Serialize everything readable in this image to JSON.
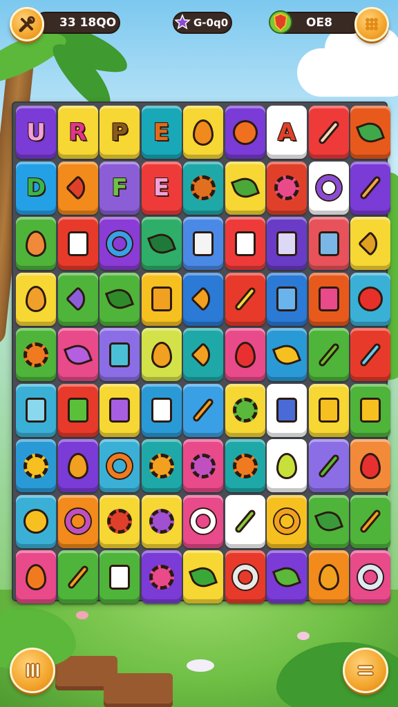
{
  "hud": {
    "score_text": "33 18QO",
    "level_text": "G-0ԛ0",
    "coins_text": "OE8",
    "colors": {
      "pill_bg": "#3a2a24",
      "button_orange": "#f3a52c",
      "star_purple": "#8b4bd6",
      "shield_red": "#e0402a"
    },
    "icons": {
      "left_button": "tools-icon",
      "star": "star-icon",
      "shield": "shield-icon",
      "right_button": "grid-menu-icon"
    }
  },
  "board": {
    "rows": [
      [
        {
          "bg": "#7a3bd6",
          "glyph": "U",
          "glyphColor": "#f4a0d8"
        },
        {
          "bg": "#f6d733",
          "glyph": "R",
          "glyphColor": "#e2348a"
        },
        {
          "bg": "#f6d733",
          "glyph": "P",
          "glyphColor": "#8a5a1a"
        },
        {
          "bg": "#19a8b8",
          "glyph": "E",
          "glyphColor": "#e06a1c"
        },
        {
          "bg": "#f6d733",
          "icon": "fruit-icon",
          "shape": "drop",
          "color": "#f08a1c"
        },
        {
          "bg": "#7a3bd6",
          "icon": "donut-icon",
          "shape": "round",
          "color": "#f07020"
        },
        {
          "bg": "#ffffff",
          "glyph": "A",
          "glyphColor": "#e0402a"
        },
        {
          "bg": "#ef3a3a",
          "icon": "pencil-icon",
          "shape": "stick",
          "color": "#f3d9c0"
        },
        {
          "bg": "#e85a1c",
          "icon": "leaf-icon",
          "shape": "leafy",
          "color": "#3fa84a"
        }
      ],
      [
        {
          "bg": "#24a0e6",
          "glyph": "D",
          "glyphColor": "#39b54a"
        },
        {
          "bg": "#f28a1c",
          "icon": "heart-icon",
          "shape": "arrow",
          "color": "#e0402a"
        },
        {
          "bg": "#8b5ed8",
          "glyph": "F",
          "glyphColor": "#6ec04a"
        },
        {
          "bg": "#ef3a3a",
          "glyph": "E",
          "glyphColor": "#f4a0d8"
        },
        {
          "bg": "#1fa8a8",
          "icon": "gear-icon",
          "shape": "gear",
          "color": "#e07020"
        },
        {
          "bg": "#f6d733",
          "icon": "leaf-icon",
          "shape": "leafy",
          "color": "#4aa838"
        },
        {
          "bg": "#e0402a",
          "icon": "flower-icon",
          "shape": "gear",
          "color": "#e84a8a"
        },
        {
          "bg": "#ffffff",
          "icon": "ring-icon",
          "shape": "ring",
          "color": "#8b4bd6"
        },
        {
          "bg": "#7a3bd6",
          "icon": "pencil-icon",
          "shape": "stick",
          "color": "#f3a64a"
        }
      ],
      [
        {
          "bg": "#4fb43a",
          "icon": "carrot-icon",
          "shape": "drop",
          "color": "#f08a3a"
        },
        {
          "bg": "#e83a2a",
          "icon": "box-icon",
          "shape": "square",
          "color": "#ffffff"
        },
        {
          "bg": "#8b3bd6",
          "icon": "ring-icon",
          "shape": "ring",
          "color": "#3aa0e6"
        },
        {
          "bg": "#2fae6a",
          "icon": "sprout-icon",
          "shape": "leafy",
          "color": "#1f7a3a"
        },
        {
          "bg": "#4a8ae6",
          "icon": "cube-icon",
          "shape": "square",
          "color": "#f4f4f4"
        },
        {
          "bg": "#ef3a3a",
          "icon": "bottle-icon",
          "shape": "square",
          "color": "#ffffff"
        },
        {
          "bg": "#6a3bc6",
          "icon": "cassette-icon",
          "shape": "square",
          "color": "#dcd8f6"
        },
        {
          "bg": "#e8525a",
          "icon": "jar-icon",
          "shape": "square",
          "color": "#7ab6e6"
        },
        {
          "bg": "#f6d733",
          "icon": "tick-icon",
          "shape": "arrow",
          "color": "#e0a020"
        }
      ],
      [
        {
          "bg": "#f6d733",
          "icon": "pear-icon",
          "shape": "drop",
          "color": "#f0a02a"
        },
        {
          "bg": "#4fb43a",
          "icon": "arrow-icon",
          "shape": "arrow",
          "color": "#8b5ed8"
        },
        {
          "bg": "#4fb43a",
          "icon": "sprout-icon",
          "shape": "leafy",
          "color": "#2f8a2a"
        },
        {
          "bg": "#f6c020",
          "icon": "bag-icon",
          "shape": "square",
          "color": "#f2a020"
        },
        {
          "bg": "#2a7ad6",
          "icon": "triangle-icon",
          "shape": "arrow",
          "color": "#f2a020"
        },
        {
          "bg": "#e83a2a",
          "icon": "crayon-icon",
          "shape": "stick",
          "color": "#f6d733"
        },
        {
          "bg": "#2a7ad6",
          "icon": "tile-icon",
          "shape": "square",
          "color": "#6ab4ee"
        },
        {
          "bg": "#e85a1c",
          "icon": "book-icon",
          "shape": "square",
          "color": "#e84a8a"
        },
        {
          "bg": "#3ab0d6",
          "icon": "apple-icon",
          "shape": "round",
          "color": "#e8302a"
        }
      ],
      [
        {
          "bg": "#4fb43a",
          "icon": "gear-icon",
          "shape": "gear",
          "color": "#f07a20"
        },
        {
          "bg": "#e84a8a",
          "icon": "bunch-icon",
          "shape": "leafy",
          "color": "#b45ee0"
        },
        {
          "bg": "#8b6ee6",
          "icon": "ticket-icon",
          "shape": "square",
          "color": "#4ac0d6"
        },
        {
          "bg": "#d4e24a",
          "icon": "mango-icon",
          "shape": "drop",
          "color": "#f2a020"
        },
        {
          "bg": "#1fa8a8",
          "icon": "mushroom-icon",
          "shape": "arrow",
          "color": "#f2a020"
        },
        {
          "bg": "#e84a8a",
          "icon": "heart-icon",
          "shape": "drop",
          "color": "#e83030"
        },
        {
          "bg": "#2a9ad6",
          "icon": "tulip-icon",
          "shape": "leafy",
          "color": "#f6c020"
        },
        {
          "bg": "#4fb43a",
          "icon": "pencil-icon",
          "shape": "stick",
          "color": "#6ac02a"
        },
        {
          "bg": "#e83a2a",
          "icon": "marker-icon",
          "shape": "stick",
          "color": "#6ac8ee"
        }
      ],
      [
        {
          "bg": "#3ab0d6",
          "icon": "jar-icon",
          "shape": "square",
          "color": "#8ad8ee"
        },
        {
          "bg": "#e83a2a",
          "icon": "bottle-icon",
          "shape": "square",
          "color": "#5ac03a"
        },
        {
          "bg": "#f6d733",
          "icon": "book-icon",
          "shape": "square",
          "color": "#a85ee0"
        },
        {
          "bg": "#2a9ad6",
          "icon": "tag-icon",
          "shape": "square",
          "color": "#ffffff"
        },
        {
          "bg": "#3aa0e6",
          "icon": "crayon-icon",
          "shape": "stick",
          "color": "#f2a020"
        },
        {
          "bg": "#f6d733",
          "icon": "flower-icon",
          "shape": "gear",
          "color": "#5ab83a"
        },
        {
          "bg": "#ffffff",
          "icon": "carton-icon",
          "shape": "square",
          "color": "#4a6ad6"
        },
        {
          "bg": "#f6d733",
          "icon": "boot-icon",
          "shape": "square",
          "color": "#f6c020"
        },
        {
          "bg": "#4fb43a",
          "icon": "bag-icon",
          "shape": "square",
          "color": "#f6c020"
        }
      ],
      [
        {
          "bg": "#2a9ad6",
          "icon": "gear-icon",
          "shape": "gear",
          "color": "#f6c020"
        },
        {
          "bg": "#7a3bd6",
          "icon": "bell-icon",
          "shape": "drop",
          "color": "#f2a020"
        },
        {
          "bg": "#3ab0d6",
          "icon": "donut-icon",
          "shape": "ring",
          "color": "#f07a20"
        },
        {
          "bg": "#1fa8a8",
          "icon": "gear-icon",
          "shape": "gear",
          "color": "#f2a020"
        },
        {
          "bg": "#e84a8a",
          "icon": "flower-icon",
          "shape": "gear",
          "color": "#c050c0"
        },
        {
          "bg": "#1fa8a8",
          "icon": "gear-icon",
          "shape": "gear",
          "color": "#f07a20"
        },
        {
          "bg": "#ffffff",
          "icon": "lemon-icon",
          "shape": "drop",
          "color": "#c8e03a"
        },
        {
          "bg": "#8b6ee6",
          "icon": "pen-icon",
          "shape": "stick",
          "color": "#5ab83a"
        },
        {
          "bg": "#f28a3a",
          "icon": "heart-icon",
          "shape": "drop",
          "color": "#e83030"
        }
      ],
      [
        {
          "bg": "#3ab0d6",
          "icon": "lemon-icon",
          "shape": "round",
          "color": "#f6c020"
        },
        {
          "bg": "#f28a1c",
          "icon": "ring-icon",
          "shape": "ring",
          "color": "#c050c0"
        },
        {
          "bg": "#f6d733",
          "icon": "flower-icon",
          "shape": "gear",
          "color": "#e0402a"
        },
        {
          "bg": "#f6d733",
          "icon": "flower-icon",
          "shape": "gear",
          "color": "#a050d0"
        },
        {
          "bg": "#e84a8a",
          "icon": "ring-icon",
          "shape": "ring",
          "color": "#ffffff"
        },
        {
          "bg": "#ffffff",
          "icon": "cucumber-icon",
          "shape": "stick",
          "color": "#8ac83a"
        },
        {
          "bg": "#f6c020",
          "icon": "ring-icon",
          "shape": "ring",
          "color": "#f2a020"
        },
        {
          "bg": "#4fb43a",
          "icon": "leaf-icon",
          "shape": "leafy",
          "color": "#3a9a3a"
        },
        {
          "bg": "#4fb43a",
          "icon": "carrot-icon",
          "shape": "stick",
          "color": "#f2a020"
        }
      ],
      [
        {
          "bg": "#e84a8a",
          "icon": "fruit-icon",
          "shape": "drop",
          "color": "#f07a20"
        },
        {
          "bg": "#4fb43a",
          "icon": "carrot-icon",
          "shape": "stick",
          "color": "#f2a020"
        },
        {
          "bg": "#4fb43a",
          "icon": "box-icon",
          "shape": "square",
          "color": "#ffffff"
        },
        {
          "bg": "#7a3bd6",
          "icon": "gear-icon",
          "shape": "gear",
          "color": "#e84a8a"
        },
        {
          "bg": "#f6d733",
          "icon": "leaf-icon",
          "shape": "leafy",
          "color": "#3aa838"
        },
        {
          "bg": "#e83a2a",
          "icon": "key-icon",
          "shape": "ring",
          "color": "#e8e8e8"
        },
        {
          "bg": "#7a3bd6",
          "icon": "leaf-icon",
          "shape": "leafy",
          "color": "#5ab83a"
        },
        {
          "bg": "#f28a1c",
          "icon": "mango-icon",
          "shape": "drop",
          "color": "#f2a020"
        },
        {
          "bg": "#e84a8a",
          "icon": "ring-icon",
          "shape": "ring",
          "color": "#dfe8f6"
        }
      ]
    ]
  },
  "footer": {
    "icons": {
      "left_button": "pause-icon",
      "right_button": "menu-icon"
    }
  }
}
